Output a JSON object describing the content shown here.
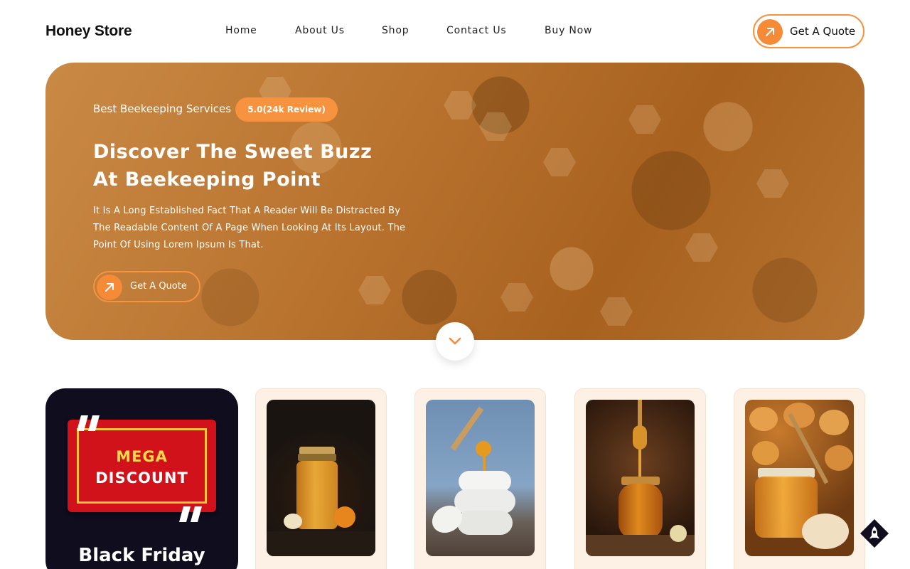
{
  "header": {
    "brand": "Honey Store",
    "nav": [
      "Home",
      "About Us",
      "Shop",
      "Contact Us",
      "Buy Now"
    ],
    "cta_label": "Get A Quote"
  },
  "hero": {
    "tagline": "Best Beekeeping Services",
    "rating_badge": "5.0(24k Review)",
    "title_line1": "Discover The Sweet Buzz",
    "title_line2": "At Beekeeping Point",
    "description": "It Is A Long Established Fact That A Reader Will Be Distracted By The Readable Content Of A Page When Looking At Its Layout. The Point Of Using Lorem Ipsum Is That.",
    "cta_label": "Get A Quote"
  },
  "promo": {
    "banner_line1": "MEGA",
    "banner_line2": "DISCOUNT",
    "title": "Black Friday"
  },
  "products": [
    {
      "image": "honey-jar-with-flowers"
    },
    {
      "image": "honey-pot-with-dipper"
    },
    {
      "image": "honey-jar-with-dipper"
    },
    {
      "image": "honey-jar-with-biscuits"
    }
  ],
  "icons": {
    "cta_icon": "arrow-up-right-icon",
    "scroll_icon": "chevron-down-icon",
    "back_to_top_icon": "rocket-icon"
  },
  "colors": {
    "accent": "#f58b36",
    "hero_overlay": "#b9732f",
    "promo_bg": "#0f0d1e",
    "card_bg": "#fdf0e4"
  }
}
